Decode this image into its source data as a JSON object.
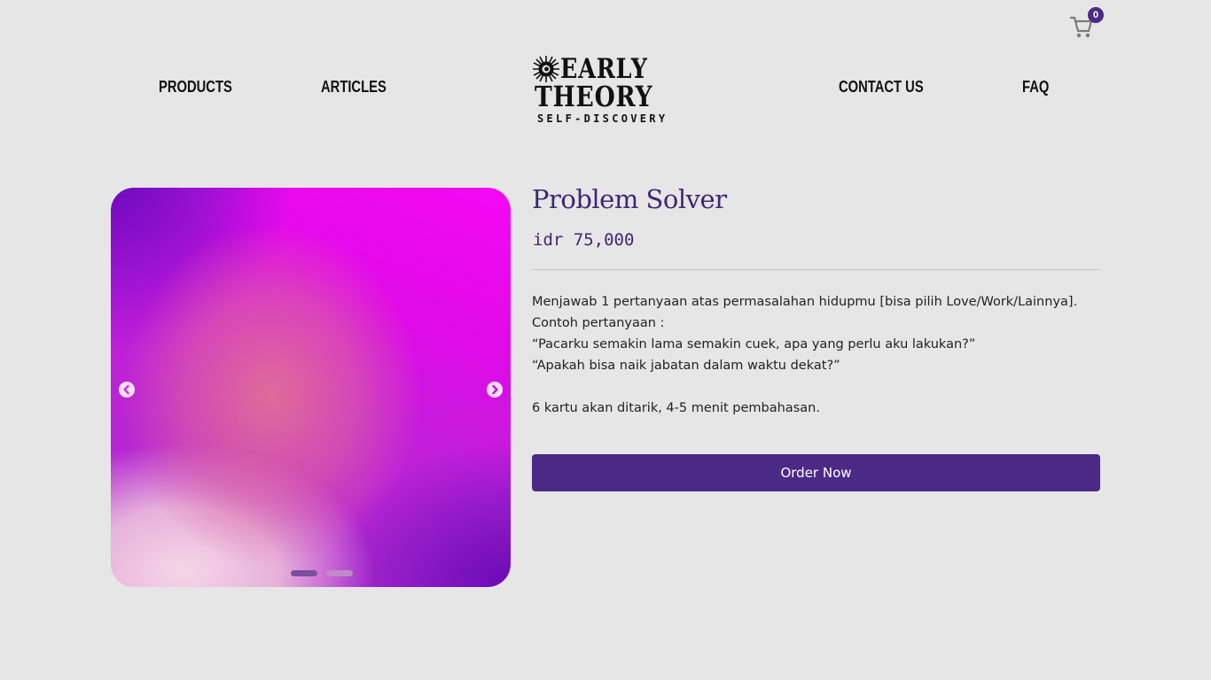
{
  "header": {
    "cart": {
      "icon": "shopping-cart-icon",
      "count": "0"
    },
    "nav_left": [
      {
        "label": "PRODUCTS"
      },
      {
        "label": "ARTICLES"
      }
    ],
    "nav_right": [
      {
        "label": "CONTACT US"
      },
      {
        "label": "FAQ"
      }
    ],
    "logo": {
      "line1": "EARLY",
      "line2": "THEORY",
      "tagline": "SELF-DISCOVERY"
    }
  },
  "carousel": {
    "prev_icon": "chevron-left-icon",
    "next_icon": "chevron-right-icon",
    "slide_count": 2,
    "active_slide": 1
  },
  "product": {
    "title": "Problem Solver",
    "price": "idr 75,000",
    "description": [
      "Menjawab 1 pertanyaan atas permasalahan hidupmu [bisa pilih Love/Work/Lainnya].",
      "Contoh pertanyaan :",
      "“Pacarku semakin lama semakin cuek, apa yang perlu aku lakukan?”",
      "“Apakah bisa naik jabatan dalam waktu dekat?”",
      "",
      "6 kartu akan ditarik, 4-5 menit pembahasan."
    ],
    "order_label": "Order Now"
  },
  "colors": {
    "background": "#e6e6e6",
    "accent": "#4b2a86",
    "title": "#3d2873"
  }
}
